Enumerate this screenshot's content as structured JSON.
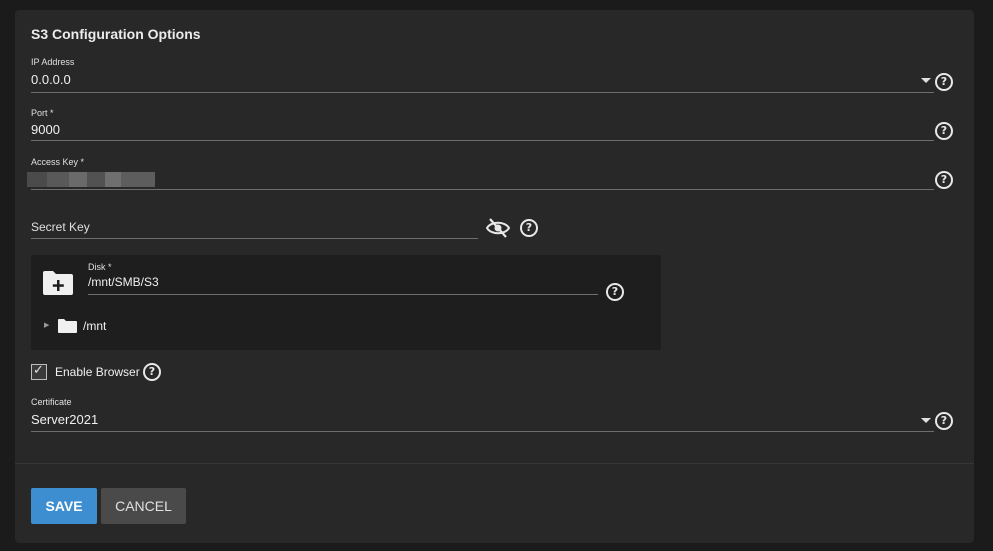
{
  "section_title": "S3 Configuration Options",
  "fields": {
    "ip_address": {
      "label": "IP Address",
      "value": "0.0.0.0"
    },
    "port": {
      "label": "Port *",
      "value": "9000"
    },
    "access_key": {
      "label": "Access Key *"
    },
    "secret_key": {
      "placeholder": "Secret Key"
    },
    "disk": {
      "label": "Disk *",
      "value": "/mnt/SMB/S3"
    },
    "tree_root": "/mnt",
    "enable_browser": {
      "label": "Enable Browser",
      "checked": true
    },
    "certificate": {
      "label": "Certificate",
      "value": "Server2021"
    }
  },
  "help_glyph": "?",
  "check_glyph": "✓",
  "tree_arrow_glyph": "▶",
  "buttons": {
    "save": "SAVE",
    "cancel": "CANCEL"
  },
  "colors": {
    "accent": "#3d8ed0",
    "card": "#282828",
    "background": "#1b1b1b"
  },
  "icons": [
    "caret-down-icon",
    "help-icon",
    "eye-off-icon",
    "folder-add-icon",
    "folder-icon",
    "tree-expand-icon",
    "checkmark-icon"
  ]
}
